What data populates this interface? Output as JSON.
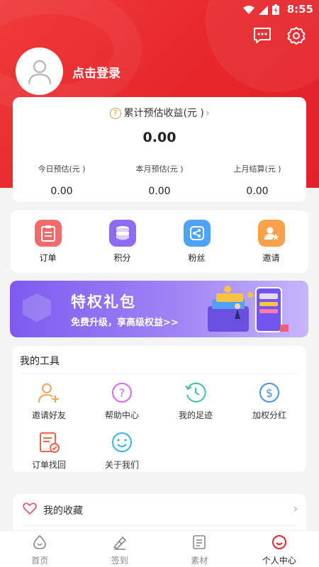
{
  "status_bar": {
    "time": "8:55"
  },
  "profile": {
    "login_label": "点击登录"
  },
  "earnings": {
    "title": "累计预估收益(元 )",
    "total": "0.00",
    "columns": [
      {
        "label": "今日预估(元 )",
        "value": "0.00"
      },
      {
        "label": "本月预估(元 )",
        "value": "0.00"
      },
      {
        "label": "上月结算(元 )",
        "value": "0.00"
      }
    ]
  },
  "quick_menu": [
    {
      "label": "订单",
      "icon": "clipboard-icon",
      "color": "#f26b6b"
    },
    {
      "label": "积分",
      "icon": "coins-icon",
      "color": "#8d6cf2"
    },
    {
      "label": "粉丝",
      "icon": "share-icon",
      "color": "#4fa3f7"
    },
    {
      "label": "邀请",
      "icon": "user-star-icon",
      "color": "#f7a14a"
    }
  ],
  "banner": {
    "title": "特权礼包",
    "subtitle": "免费升级，享高级权益>>"
  },
  "tools": {
    "title": "我的工具",
    "items": [
      {
        "label": "邀请好友",
        "icon": "invite-friend-icon",
        "color": "#f4a25b"
      },
      {
        "label": "帮助中心",
        "icon": "help-icon",
        "color": "#d26be8"
      },
      {
        "label": "我的足迹",
        "icon": "history-icon",
        "color": "#43c0a8"
      },
      {
        "label": "加权分红",
        "icon": "dollar-icon",
        "color": "#4b8ff0"
      },
      {
        "label": "订单找回",
        "icon": "order-recover-icon",
        "color": "#f0634f"
      },
      {
        "label": "关于我们",
        "icon": "smile-icon",
        "color": "#35b3e6"
      }
    ]
  },
  "favorites": {
    "label": "我的收藏"
  },
  "tabbar": [
    {
      "label": "首页",
      "icon": "home-icon",
      "active": false
    },
    {
      "label": "签到",
      "icon": "checkin-icon",
      "active": false
    },
    {
      "label": "素材",
      "icon": "material-icon",
      "active": false
    },
    {
      "label": "个人中心",
      "icon": "profile-icon",
      "active": true
    }
  ]
}
